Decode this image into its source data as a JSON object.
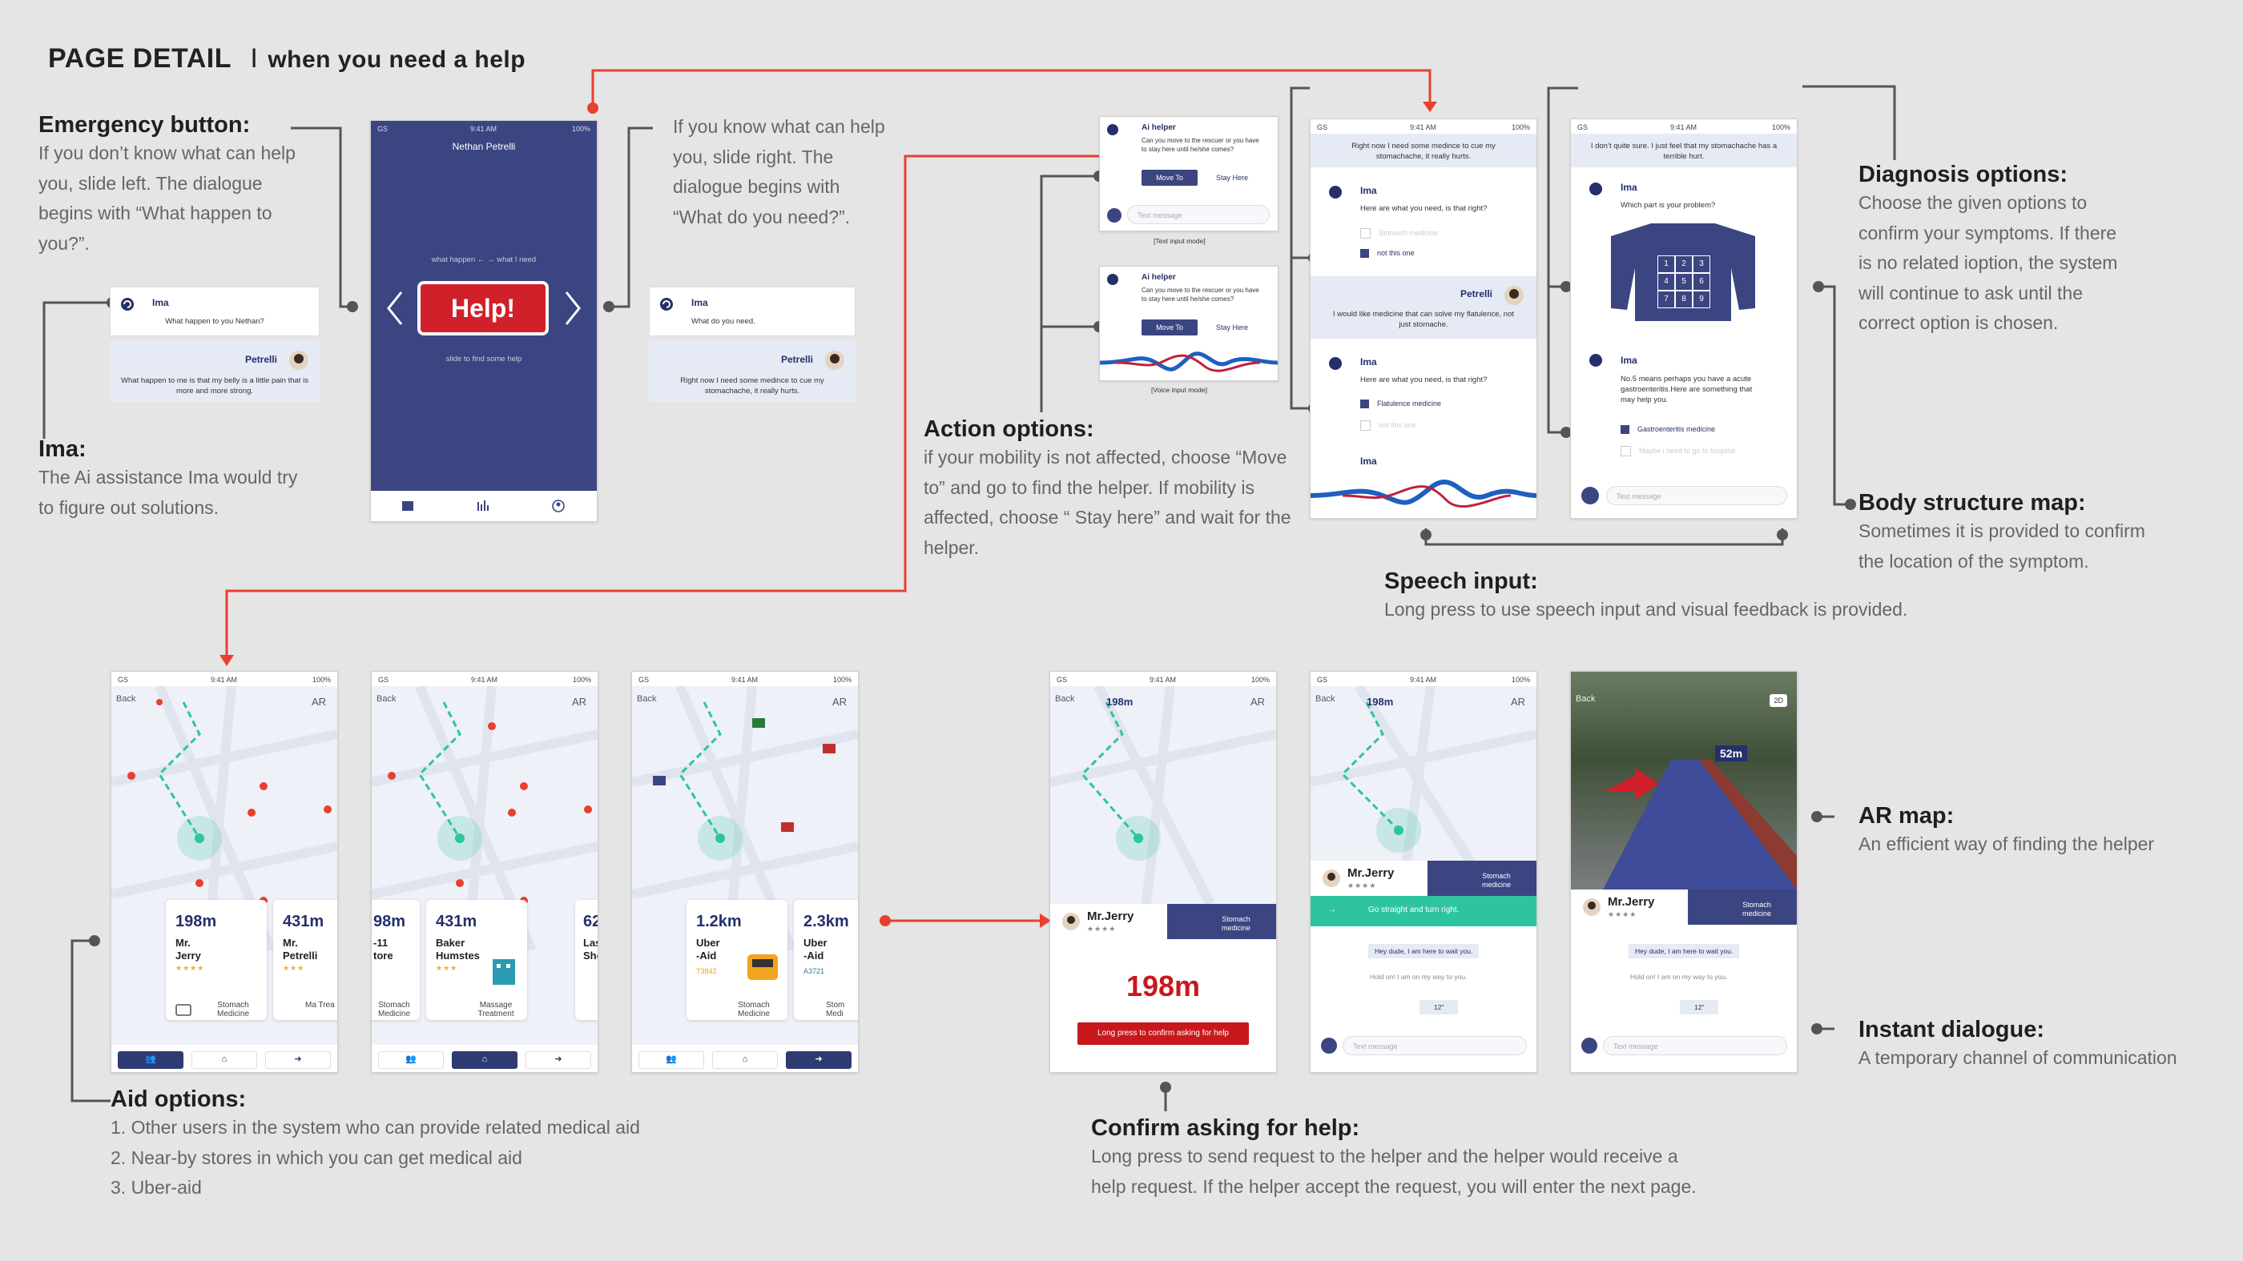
{
  "title": {
    "main": "PAGE DETAIL",
    "sep": "I",
    "sub": "when you need a help"
  },
  "annotations": {
    "emergency": {
      "heading": "Emergency button:",
      "lines": [
        "If you don’t know what can help",
        "you, slide left. The dialogue",
        "begins with “What happen to",
        "you?”."
      ]
    },
    "slide_right": {
      "lines": [
        "If you know what can help",
        "you, slide right. The",
        "dialogue begins with",
        "“What do you need?”."
      ]
    },
    "ima": {
      "heading": "Ima:",
      "lines": [
        "The Ai assistance Ima would try",
        "to figure out solutions."
      ]
    },
    "action": {
      "heading": "Action options:",
      "lines": [
        "if your mobility is not affected, choose “Move",
        "to” and go to find the helper. If mobility is",
        "affected, choose “ Stay here” and wait for the",
        "helper."
      ]
    },
    "speech": {
      "heading": "Speech input:",
      "lines": [
        "Long press to use speech input and visual feedback is provided."
      ]
    },
    "diagnosis": {
      "heading": "Diagnosis options:",
      "lines": [
        "Choose the given options to",
        "confirm your symptoms. If there",
        "is no related ioption, the system",
        "will continue to ask until the",
        "correct option is chosen."
      ]
    },
    "body": {
      "heading": "Body structure map:",
      "lines": [
        "Sometimes it is provided to confirm",
        "the location of the symptom."
      ]
    },
    "aid": {
      "heading": "Aid options:",
      "lines": [
        "1. Other users in the system who can provide related medical aid",
        "2. Near-by stores in which you can get medical aid",
        "3. Uber-aid"
      ]
    },
    "confirm": {
      "heading": "Confirm asking for help:",
      "lines": [
        "Long press to send request to the helper and the helper would receive a",
        "help request. If the helper accept the request, you will enter the next page."
      ]
    },
    "armap": {
      "heading": "AR map:",
      "lines": [
        "An efficient way of finding the helper"
      ]
    },
    "instant": {
      "heading": "Instant dialogue:",
      "lines": [
        "A temporary channel of communication"
      ]
    }
  },
  "status": {
    "carrier": "GS",
    "time": "9:41 AM",
    "battery": "100%"
  },
  "help_screen": {
    "user": "Nethan Petrelli",
    "slide_hint": "what happen ←  → what I need",
    "button": "Help!",
    "footer": "slide to find some help"
  },
  "dialog_left": {
    "ima_name": "Ima",
    "ima_msg": "What happen to you Nethan?",
    "user_name": "Petrelli",
    "user_msg": "What happen to me is that my belly is a little pain that is more and more strong."
  },
  "dialog_right": {
    "ima_name": "Ima",
    "ima_msg": "What do you need.",
    "user_name": "Petrelli",
    "user_msg": "Right now I need some medince to cue my stomachache, it really hurts."
  },
  "action_text": {
    "name": "Ai helper",
    "question": "Can you move to the rescuer or you have to stay here until he/she comes?",
    "move": "Move To",
    "stay": "Stay Here",
    "placeholder": "Text message",
    "caption": "[Text input mode]"
  },
  "action_voice": {
    "name": "Ai helper",
    "question": "Can you move to the rescuer or you have to stay here until he/she comes?",
    "move": "Move To",
    "stay": "Stay Here",
    "caption": "[Voice input mode]"
  },
  "chat1": {
    "top_msg": "Right now I need some medince to cue my stomachache, it really hurts.",
    "ima": "Ima",
    "q1": "Here are what you need, is that right?",
    "opt1a": "Stomach medicine",
    "opt1b": "not this one",
    "petrelli": "Petrelli",
    "reply": "I would like medicine that can solve my flatulence, not just stomache.",
    "q2": "Here are what you need, is that right?",
    "opt2a": "Flatulence medicine",
    "opt2b": "not this one",
    "ima2": "Ima"
  },
  "chat2": {
    "top_msg": "I don’t quite sure. I just feel that my stomachache has a terrible hurt.",
    "ima": "Ima",
    "q1": "Which part is your problem?",
    "grid": [
      "1",
      "2",
      "3",
      "4",
      "5",
      "6",
      "7",
      "8",
      "9"
    ],
    "ima2": "Ima",
    "q2": "No.5 means perhaps you have a acute gastroenteritis.Here are something that may help you.",
    "opt1": "Gastroenteritis medicine",
    "opt2": "Maybe i need to go to hospital",
    "placeholder": "Text message"
  },
  "map_common": {
    "back": "Back",
    "ar": "AR"
  },
  "aid_users": {
    "cards": [
      {
        "dist": "198m",
        "name1": "Mr.",
        "name2": "Jerry",
        "stars": "★★★★",
        "service": "Stomach Medicine"
      },
      {
        "dist": "431m",
        "name1": "Mr.",
        "name2": "Petrelli",
        "stars": "★★★",
        "service": "Ma Trea"
      }
    ]
  },
  "aid_stores": {
    "cards": [
      {
        "dist": "98m",
        "name1": "-11",
        "name2": "tore",
        "stars": "",
        "service": "Stomach Medicine"
      },
      {
        "dist": "431m",
        "name1": "Baker",
        "name2": "Humstes",
        "stars": "★★★",
        "service": "Massage Treatment"
      },
      {
        "dist": "62",
        "name1": "Las",
        "name2": "Sho",
        "stars": "",
        "service": ""
      }
    ]
  },
  "aid_uber": {
    "cards": [
      {
        "dist": "1.2km",
        "name1": "Uber",
        "name2": "-Aid",
        "code": "T3842",
        "service": "Stomach Medicine"
      },
      {
        "dist": "2.3km",
        "name1": "Uber",
        "name2": "-Aid",
        "code": "A3721",
        "service": "Stom Medi"
      }
    ]
  },
  "confirm_screen": {
    "dist_top": "198m",
    "helper": "Mr.Jerry",
    "stars": "★★★★",
    "service": "Stomach medicine",
    "dist_big": "198m",
    "button": "Long press to confirm asking for help"
  },
  "dialog_screen": {
    "dist_top": "198m",
    "helper": "Mr.Jerry",
    "stars": "★★★★",
    "service": "Stomach medicine",
    "banner": "Go straight and turn right.",
    "m1": "Hey dude, I am here to wait you.",
    "m2": "Hold on! I am on my way to you.",
    "m3": "12\"",
    "placeholder": "Text message"
  },
  "ar_screen": {
    "back": "Back",
    "mode": "2D",
    "dist": "52m",
    "helper": "Mr.Jerry",
    "stars": "★★★★",
    "service": "Stomach medicine",
    "m1": "Hey dude, I am here to wait you.",
    "m2": "Hold on! I am on my way to you.",
    "m3": "12\"",
    "placeholder": "Text message"
  },
  "colors": {
    "navy": "#3b4581",
    "red": "#e8402e",
    "teal": "#2ec4a0",
    "bg": "#e5e5e5"
  }
}
